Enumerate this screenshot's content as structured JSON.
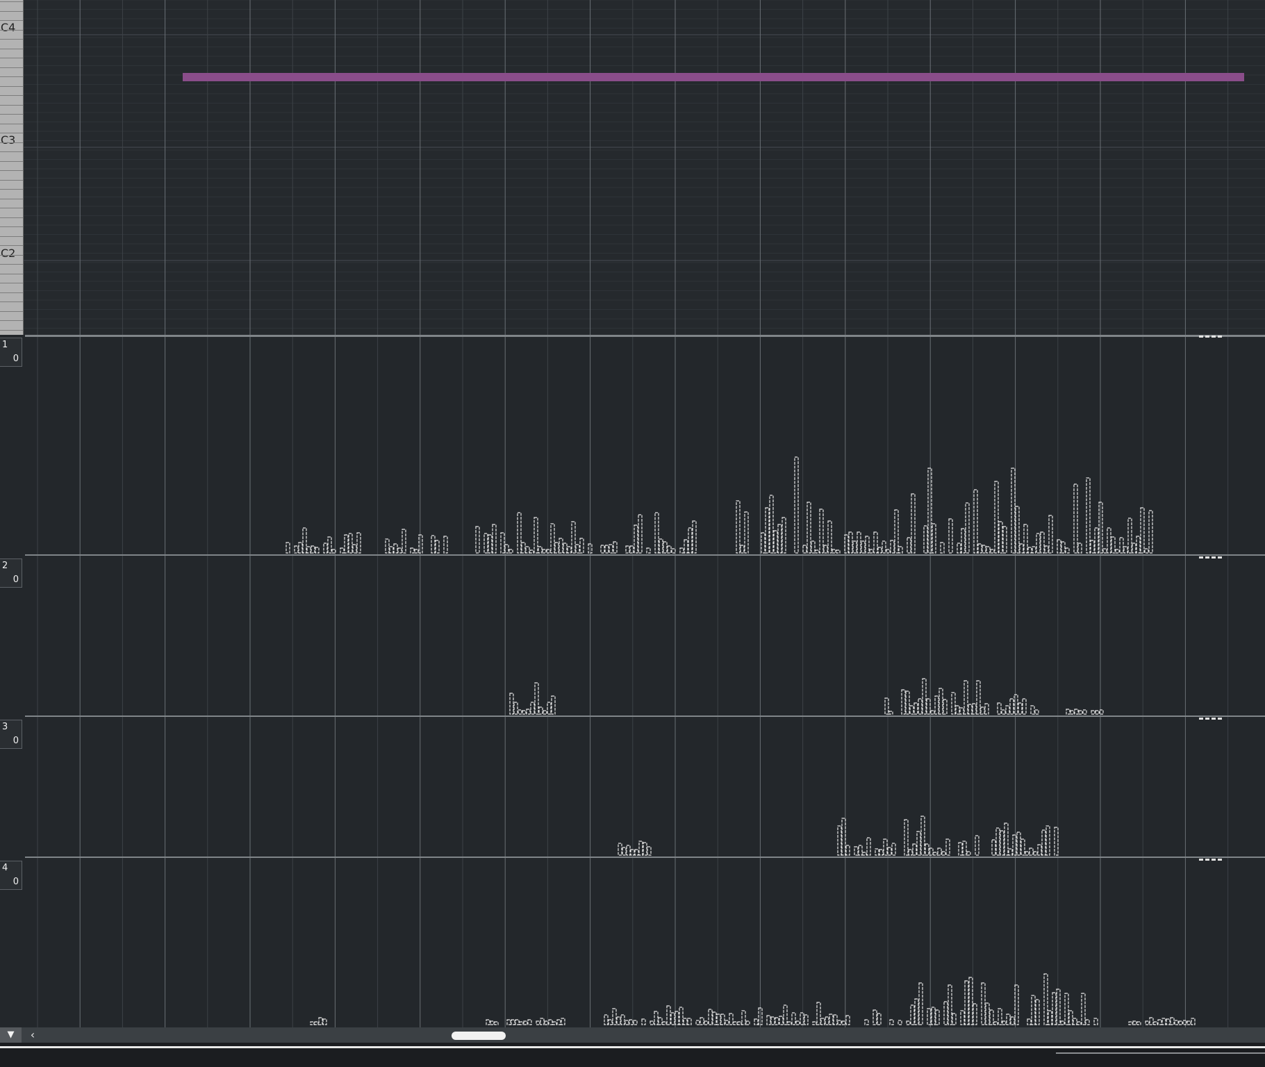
{
  "piano_roll": {
    "octave_labels": [
      "C4",
      "C3",
      "C2"
    ],
    "note_color": "#8a4d8a"
  },
  "lanes": [
    {
      "index": "1",
      "value": "0"
    },
    {
      "index": "2",
      "value": "0"
    },
    {
      "index": "3",
      "value": "0"
    },
    {
      "index": "4",
      "value": "0"
    }
  ],
  "icons": {
    "down_arrow": "▼",
    "left_arrow": "‹"
  },
  "colors": {
    "background": "#23272b",
    "grid_line": "#3d4247",
    "grid_line_bar": "#6a7075",
    "bar_fill": "#e6e6e6"
  }
}
